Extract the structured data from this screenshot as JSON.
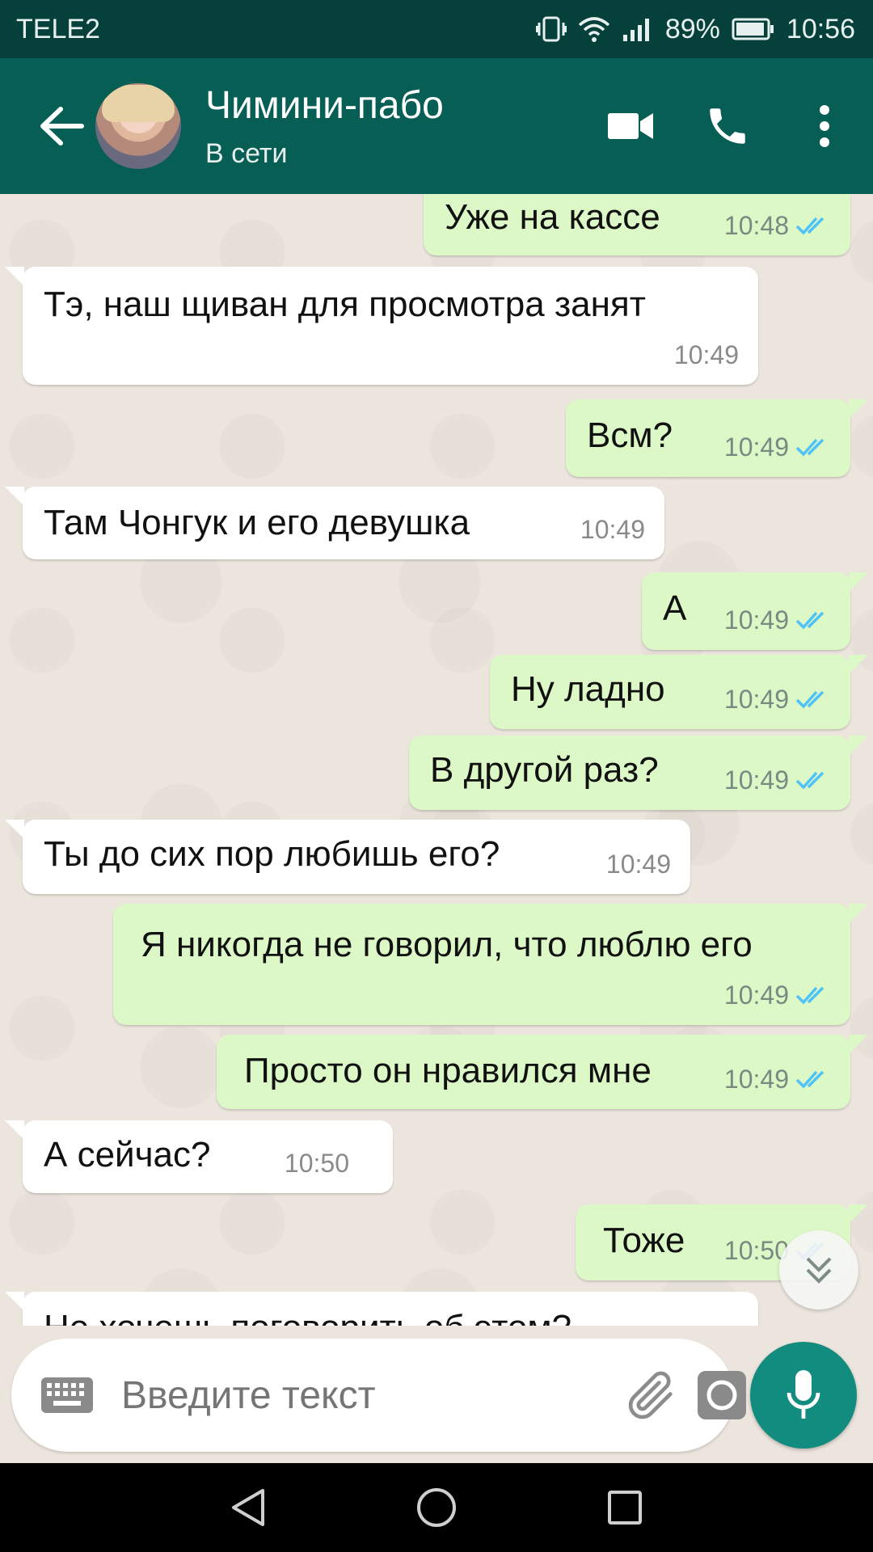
{
  "status_bar": {
    "carrier": "TELE2",
    "battery": "89%",
    "time": "10:56"
  },
  "header": {
    "contact_name": "Чимини-пабо",
    "contact_status": "В сети"
  },
  "messages": [
    {
      "dir": "out",
      "text": "Уже на кассе",
      "time": "10:48",
      "read": true
    },
    {
      "dir": "in",
      "text": "Тэ, наш щиван для просмотра занят",
      "time": "10:49"
    },
    {
      "dir": "out",
      "text": "Всм?",
      "time": "10:49",
      "read": true
    },
    {
      "dir": "in",
      "text": "Там Чонгук и его девушка",
      "time": "10:49"
    },
    {
      "dir": "out",
      "text": "А",
      "time": "10:49",
      "read": true
    },
    {
      "dir": "out",
      "text": "Ну ладно",
      "time": "10:49",
      "read": true
    },
    {
      "dir": "out",
      "text": "В другой раз?",
      "time": "10:49",
      "read": true
    },
    {
      "dir": "in",
      "text": "Ты до сих пор любишь его?",
      "time": "10:49"
    },
    {
      "dir": "out",
      "text": "Я никогда не говорил, что люблю его",
      "time": "10:49",
      "read": true
    },
    {
      "dir": "out",
      "text": "Просто он нравился мне",
      "time": "10:49",
      "read": true
    },
    {
      "dir": "in",
      "text": "А сейчас?",
      "time": "10:50"
    },
    {
      "dir": "out",
      "text": "Тоже",
      "time": "10:50",
      "read": true
    },
    {
      "dir": "in",
      "text": "Не хочешь поговорить об этом?",
      "time": ""
    }
  ],
  "composer": {
    "placeholder": "Введите текст"
  },
  "colors": {
    "header": "#075e54",
    "status_bar": "#05403a",
    "outgoing_bubble": "#dcf8c6",
    "incoming_bubble": "#ffffff",
    "read_ticks": "#4fc3f7",
    "mic_button": "#128c7e"
  },
  "icons": {
    "back": "arrow-left-icon",
    "video": "video-camera-icon",
    "call": "phone-icon",
    "menu": "more-vert-icon",
    "keyboard": "keyboard-icon",
    "attach": "paperclip-icon",
    "camera": "camera-icon",
    "mic": "microphone-icon",
    "scroll": "double-chevron-down-icon"
  }
}
